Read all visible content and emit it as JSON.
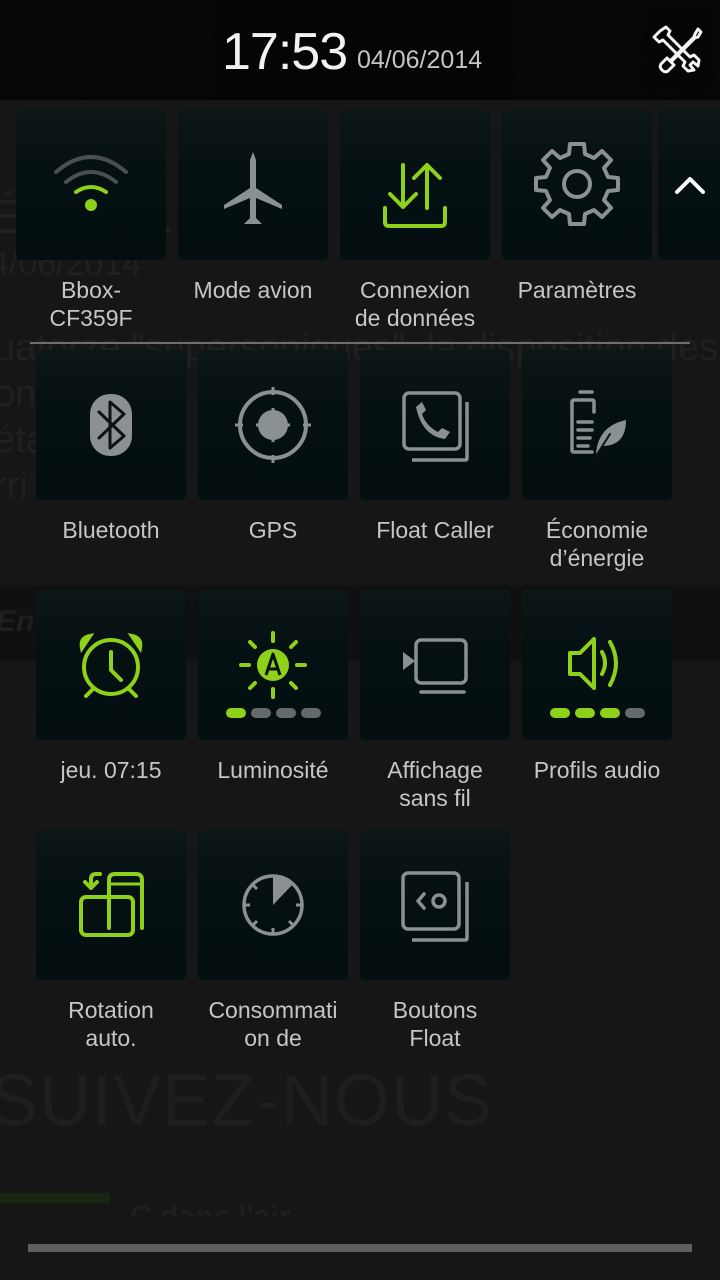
{
  "header": {
    "time": "17:53",
    "date": "04/06/2014",
    "settings_shortcut_icon": "tools-icon"
  },
  "colors": {
    "accent_active": "#8ed11a",
    "icon_inactive": "#8a9093",
    "tile_background": "#051012",
    "panel_background": "#161616"
  },
  "quick_settings": {
    "row1": [
      {
        "label": "Bbox-\nCF359F",
        "icon": "wifi-icon",
        "active": true
      },
      {
        "label": "Mode avion",
        "icon": "airplane-icon",
        "active": false
      },
      {
        "label": "Connexion\nde données",
        "icon": "data-transfer-icon",
        "active": true
      },
      {
        "label": "Paramètres",
        "icon": "gear-icon",
        "active": false
      }
    ],
    "collapse_icon": "chevron-up-icon",
    "row2": [
      {
        "label": "Bluetooth",
        "icon": "bluetooth-icon",
        "active": false
      },
      {
        "label": "GPS",
        "icon": "gps-icon",
        "active": false
      },
      {
        "label": "Float Caller",
        "icon": "float-caller-icon",
        "active": false
      },
      {
        "label": "Économie\nd’énergie",
        "icon": "power-saving-icon",
        "active": false
      }
    ],
    "row3": [
      {
        "label": "jeu. 07:15",
        "icon": "alarm-clock-icon",
        "active": true
      },
      {
        "label": "Luminosité",
        "icon": "brightness-auto-icon",
        "active": true,
        "level": 1,
        "level_max": 4
      },
      {
        "label": "Affichage\nsans fil",
        "icon": "wireless-display-icon",
        "active": false
      },
      {
        "label": "Profils audio",
        "icon": "speaker-icon",
        "active": true,
        "level": 3,
        "level_max": 4
      }
    ],
    "row4": [
      {
        "label": "Rotation\nauto.",
        "icon": "auto-rotate-icon",
        "active": true
      },
      {
        "label": "Consommati\non de",
        "icon": "usage-timer-icon",
        "active": false
      },
      {
        "label": "Boutons\nFloat",
        "icon": "float-buttons-icon",
        "active": false
      }
    ]
  },
  "background_page": {
    "heading": "É   L   E   ...",
    "date": "4/06/2014",
    "paragraph_lines": [
      "uatorze \"supersoniques\", la disposition des",
      "ons     r        2    e a",
      "éta    a    es    fo",
      "rri"
    ],
    "band_text": "En           s          z          st",
    "big_heading": "SUIVEZ-NOUS",
    "small_text": "C dans l'air"
  }
}
